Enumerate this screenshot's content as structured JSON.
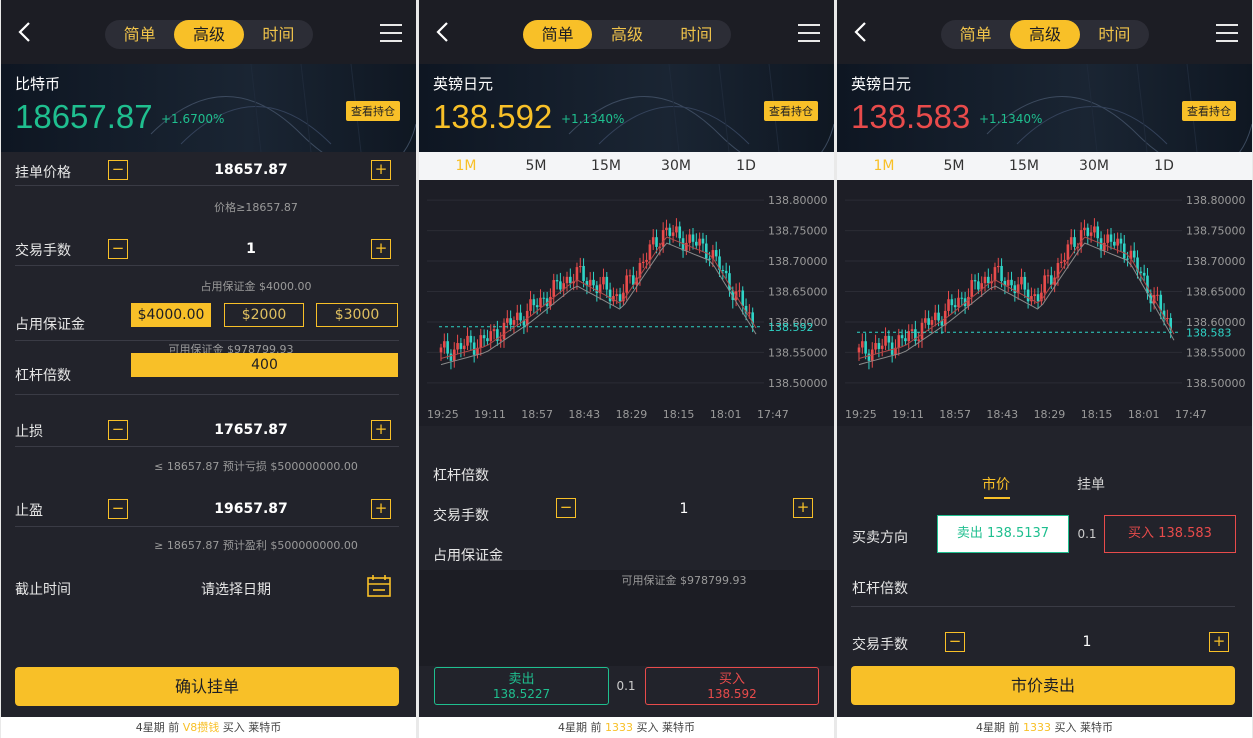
{
  "nav": {
    "tabs": [
      "简单",
      "高级",
      "时间"
    ]
  },
  "phones": [
    {
      "symbol": "比特币",
      "price": "18657.87",
      "change": "+1.6700%",
      "price_color": "#1fbf8f",
      "positions_btn": "查看持仓",
      "active_tab": 1
    },
    {
      "symbol": "英镑日元",
      "price": "138.592",
      "change": "+1.1340%",
      "price_color": "#f8c028",
      "positions_btn": "查看持仓",
      "active_tab": 0
    },
    {
      "symbol": "英镑日元",
      "price": "138.583",
      "change": "+1.1340%",
      "price_color": "#e84b4b",
      "positions_btn": "查看持仓",
      "active_tab": 1
    }
  ],
  "form": {
    "order_price_label": "挂单价格",
    "order_price": "18657.87",
    "order_price_hint": "价格≥18657.87",
    "lots_label": "交易手数",
    "lots": "1",
    "margin_hint": "占用保证金 $4000.00",
    "margin_label": "占用保证金",
    "amounts": [
      "$4000.00",
      "$2000",
      "$3000"
    ],
    "avail_margin": "可用保证金 $978799.93",
    "leverage_label": "杠杆倍数",
    "leverage": "400",
    "stoploss_label": "止损",
    "stoploss": "17657.87",
    "stoploss_hint": "≤ 18657.87 预计亏损 $500000000.00",
    "takeprofit_label": "止盈",
    "takeprofit": "19657.87",
    "takeprofit_hint": "≥ 18657.87 预计盈利 $500000000.00",
    "expiry_label": "截止时间",
    "expiry_placeholder": "请选择日期",
    "confirm": "确认挂单"
  },
  "footer1": {
    "prefix": "4星期 前",
    "name": "V8攒钱",
    "suffix": "买入 莱特币"
  },
  "footer": {
    "prefix": "4星期 前",
    "name": "1333",
    "suffix": "买入 莱特币"
  },
  "kline": {
    "intervals": [
      "1M",
      "5M",
      "15M",
      "30M",
      "1D"
    ],
    "yticks": [
      "138.80000",
      "138.75000",
      "138.70000",
      "138.65000",
      "138.60000",
      "138.55000",
      "138.50000"
    ],
    "xticks": [
      "19:25",
      "19:11",
      "18:57",
      "18:43",
      "18:29",
      "18:15",
      "18:01",
      "17:47"
    ]
  },
  "simple": {
    "leverage_label": "杠杆倍数",
    "lots_label": "交易手数",
    "lots": "1",
    "margin_label": "占用保证金",
    "avail_margin": "可用保证金 $978799.93",
    "sell_label": "卖出",
    "sell_price": "138.5227",
    "spread": "0.1",
    "buy_label": "买入",
    "buy_price": "138.592"
  },
  "market": {
    "tab_market": "市价",
    "tab_pending": "挂单",
    "direction_label": "买卖方向",
    "sell": "卖出 138.5137",
    "spread": "0.1",
    "buy": "买入 138.583",
    "leverage_label": "杠杆倍数",
    "lots_label": "交易手数",
    "lots": "1",
    "submit": "市价卖出"
  },
  "chart_data": [
    {
      "type": "line",
      "x": [
        "19:25",
        "19:11",
        "18:57",
        "18:43",
        "18:29",
        "18:15",
        "18:01",
        "17:47"
      ],
      "series": [
        {
          "values": [
            138.55,
            138.57,
            138.62,
            138.68,
            138.64,
            138.75,
            138.72,
            138.6
          ]
        }
      ],
      "ylim": [
        138.48,
        138.82
      ],
      "last_price": "138.592"
    },
    {
      "type": "line",
      "x": [
        "19:25",
        "19:11",
        "18:57",
        "18:43",
        "18:29",
        "18:15",
        "18:01",
        "17:47"
      ],
      "series": [
        {
          "values": [
            138.55,
            138.57,
            138.62,
            138.68,
            138.64,
            138.75,
            138.72,
            138.59
          ]
        }
      ],
      "ylim": [
        138.48,
        138.82
      ],
      "last_price": "138.583"
    }
  ]
}
